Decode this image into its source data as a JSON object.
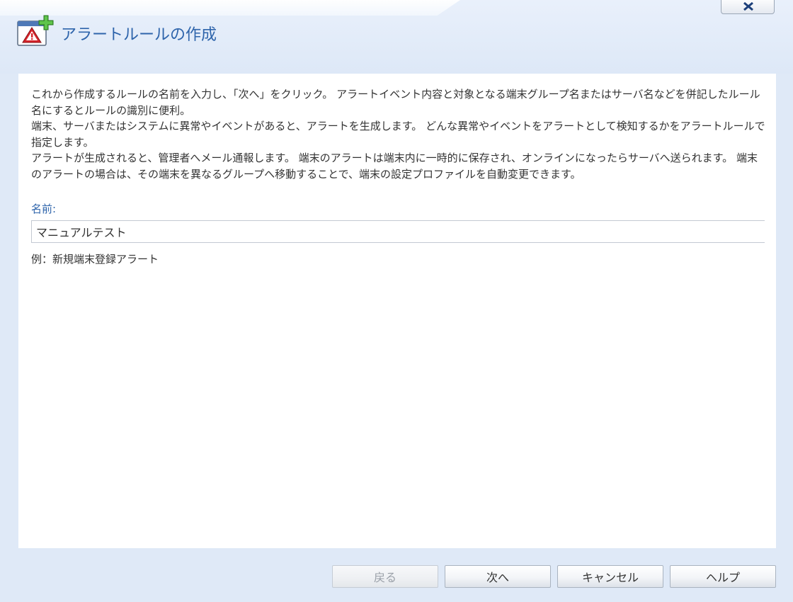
{
  "dialog": {
    "title": "アラートルールの作成",
    "icon": "alert-rule-add-icon",
    "close_icon": "close-icon"
  },
  "description": {
    "paragraphs": [
      "これから作成するルールの名前を入力し、「次へ」をクリック。 アラートイベント内容と対象となる端末グループ名またはサーバ名などを併記したルール名にするとルールの識別に便利。",
      "端末、サーバまたはシステムに異常やイベントがあると、アラートを生成します。 どんな異常やイベントをアラートとして検知するかをアラートルールで指定します。",
      "アラートが生成されると、管理者へメール通報します。 端末のアラートは端末内に一時的に保存され、オンラインになったらサーバへ送られます。 端末のアラートの場合は、その端末を異なるグループへ移動することで、端末の設定プロファイルを自動変更できます。"
    ]
  },
  "form": {
    "name_label": "名前:",
    "name_value": "マニュアルテスト",
    "example": "例：新規端末登録アラート"
  },
  "buttons": {
    "back": "戻る",
    "next": "次へ",
    "cancel": "キャンセル",
    "help": "ヘルプ"
  },
  "colors": {
    "title": "#2e64ab",
    "background": "#dfe9f7",
    "panel": "#ffffff"
  }
}
